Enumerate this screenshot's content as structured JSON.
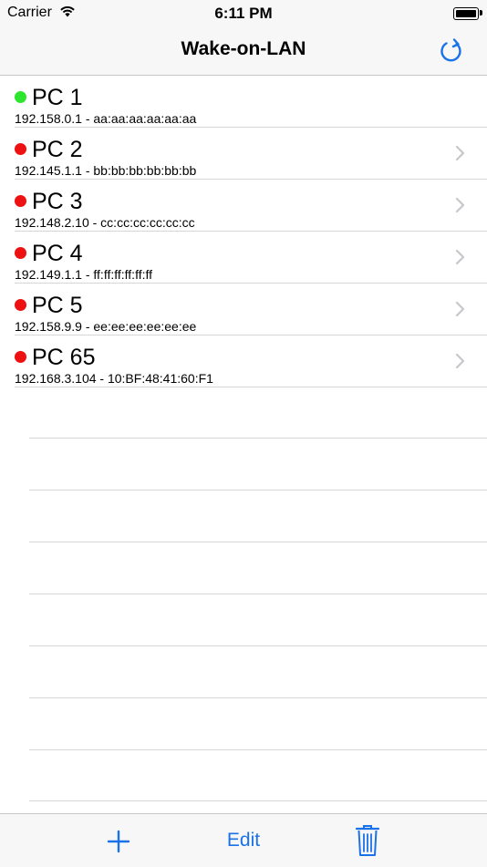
{
  "status_bar": {
    "carrier": "Carrier",
    "time": "6:11 PM",
    "icons": [
      "wifi-icon",
      "battery-icon"
    ]
  },
  "nav": {
    "title": "Wake-on-LAN",
    "refresh_icon": "refresh-icon"
  },
  "devices": [
    {
      "name": "PC 1",
      "detail": "192.158.0.1 - aa:aa:aa:aa:aa:aa",
      "status": "online",
      "status_color": "#2ee52e",
      "has_chevron": false
    },
    {
      "name": "PC 2",
      "detail": "192.145.1.1 - bb:bb:bb:bb:bb:bb",
      "status": "offline",
      "status_color": "#ee1111",
      "has_chevron": true
    },
    {
      "name": "PC 3",
      "detail": "192.148.2.10 - cc:cc:cc:cc:cc:cc",
      "status": "offline",
      "status_color": "#ee1111",
      "has_chevron": true
    },
    {
      "name": "PC 4",
      "detail": "192.149.1.1 - ff:ff:ff:ff:ff:ff",
      "status": "offline",
      "status_color": "#ee1111",
      "has_chevron": true
    },
    {
      "name": "PC 5",
      "detail": "192.158.9.9 - ee:ee:ee:ee:ee:ee",
      "status": "offline",
      "status_color": "#ee1111",
      "has_chevron": true
    },
    {
      "name": "PC 65",
      "detail": "192.168.3.104 - 10:BF:48:41:60:F1",
      "status": "offline",
      "status_color": "#ee1111",
      "has_chevron": true
    }
  ],
  "toolbar": {
    "add_icon": "plus-icon",
    "edit_label": "Edit",
    "delete_icon": "trash-icon"
  },
  "colors": {
    "accent": "#1a72e8",
    "online": "#2ee52e",
    "offline": "#ee1111",
    "bar_background": "#f7f7f7"
  }
}
